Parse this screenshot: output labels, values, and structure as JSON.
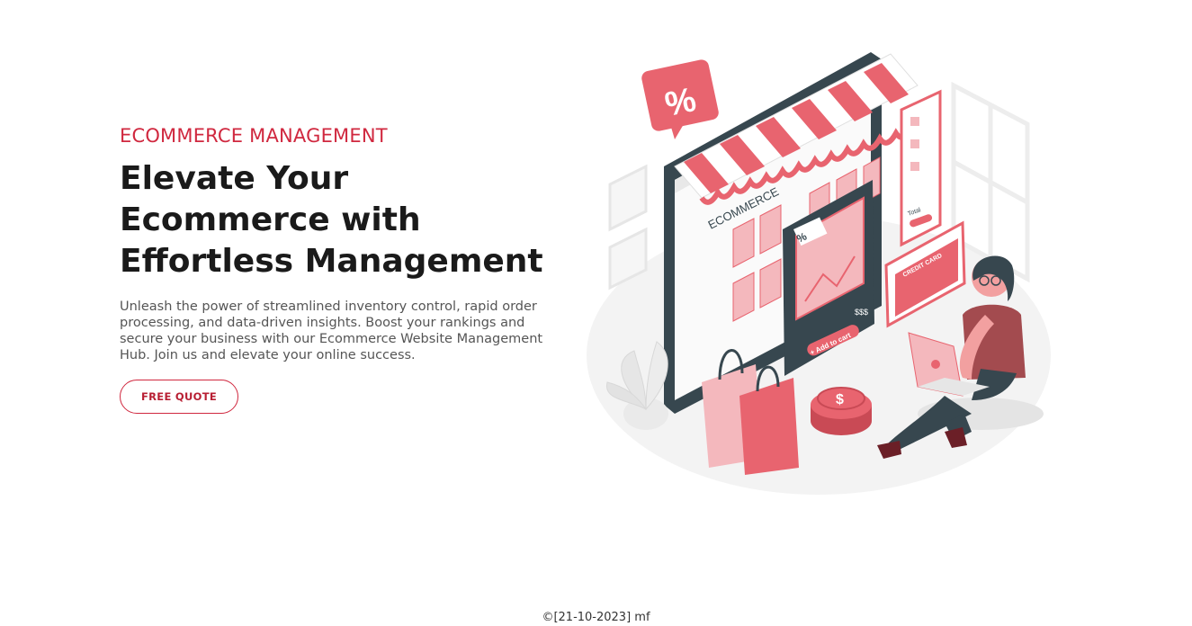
{
  "hero": {
    "eyebrow": "ECOMMERCE MANAGEMENT",
    "headline": "Elevate Your Ecommerce with Effortless Management",
    "description": "Unleash the power of streamlined inventory control, rapid order processing, and data-driven insights. Boost your rankings and secure your business with our Ecommerce Website Management Hub. Join us and elevate your online success.",
    "cta_label": "FREE QUOTE"
  },
  "illustration": {
    "store_sign": "ECOMMERCE",
    "badge_symbol": "%",
    "tag_symbol": "%",
    "price_tag": "$$$",
    "add_to_cart_label": "+ Add to cart",
    "credit_card_label": "CREDIT CARD",
    "total_label": "Total",
    "coin_symbol": "$"
  },
  "footer": {
    "copyright": "©[21-10-2023] mf"
  },
  "colors": {
    "accent": "#d0283f",
    "illustration_pink": "#e8646f",
    "illustration_light_pink": "#f4b8bd",
    "illustration_dark": "#37474f"
  }
}
